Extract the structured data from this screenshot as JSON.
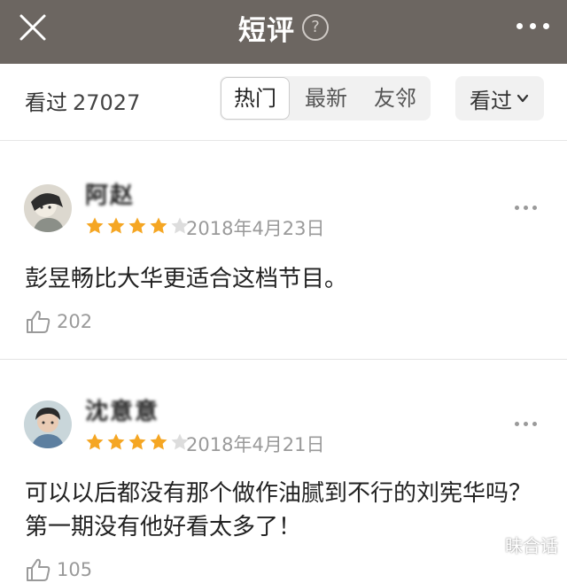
{
  "header": {
    "title": "短评",
    "help_symbol": "?"
  },
  "filter": {
    "seen_label": "看过",
    "seen_count": "27027",
    "tabs": [
      {
        "label": "热门",
        "active": true
      },
      {
        "label": "最新",
        "active": false
      },
      {
        "label": "友邻",
        "active": false
      }
    ],
    "dropdown_label": "看过"
  },
  "reviews": [
    {
      "username": "阿赵",
      "rating": 4,
      "max_rating": 5,
      "date": "2018年4月23日",
      "content": "彭昱畅比大华更适合这档节目。",
      "likes": "202"
    },
    {
      "username": "沈意意",
      "rating": 4,
      "max_rating": 5,
      "date": "2018年4月21日",
      "content": "可以以后都没有那个做作油腻到不行的刘宪华吗？第一期没有他好看太多了！",
      "likes": "105"
    }
  ],
  "watermark": "昧合话",
  "colors": {
    "header_bg": "#6c6661",
    "star_filled": "#f5a623",
    "star_empty": "#dddddd",
    "muted_text": "#9a9a9a"
  }
}
